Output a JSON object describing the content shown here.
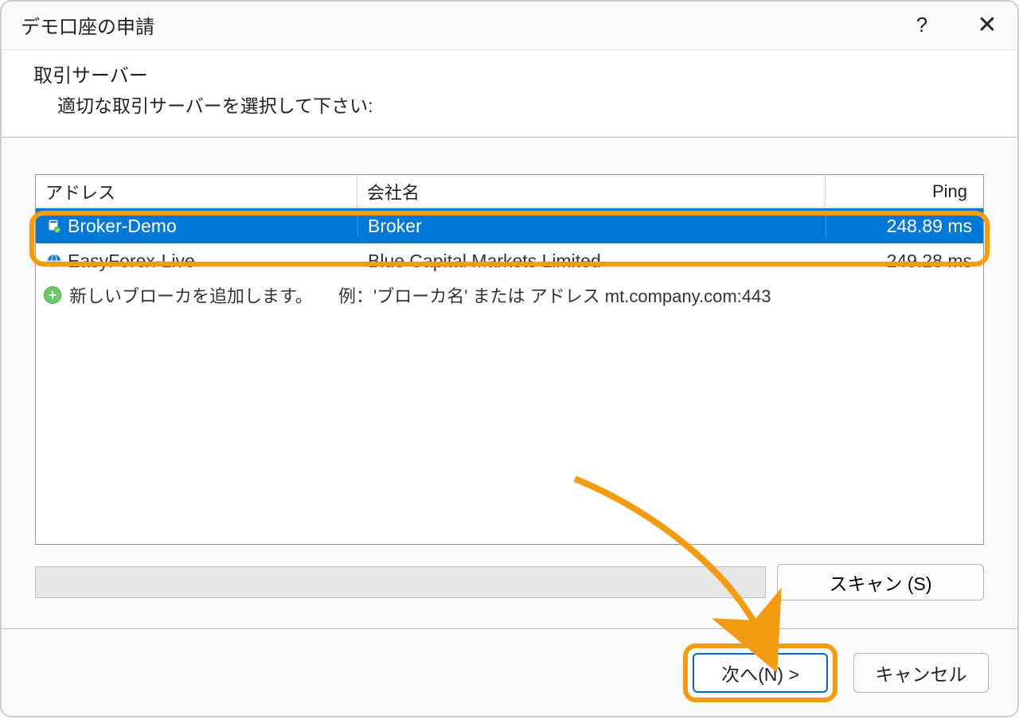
{
  "dialog": {
    "title": "デモ口座の申請",
    "help": "?",
    "close": "✕"
  },
  "header": {
    "section_title": "取引サーバー",
    "section_desc": "適切な取引サーバーを選択して下さい:"
  },
  "columns": {
    "address": "アドレス",
    "company": "会社名",
    "ping": "Ping"
  },
  "rows": [
    {
      "address": "Broker-Demo",
      "company": "Broker",
      "ping": "248.89 ms",
      "selected": true
    },
    {
      "address": "EasyForex-Live",
      "company": "Blue Capital Markets Limited",
      "ping": "249.28 ms",
      "selected": false
    }
  ],
  "add_row": {
    "label": "新しいブローカを追加します。",
    "hint": "例：'ブローカ名' または アドレス mt.company.com:443"
  },
  "buttons": {
    "scan": "スキャン (S)",
    "next": "次へ(N) >",
    "cancel": "キャンセル"
  },
  "colors": {
    "selection": "#0078d7",
    "highlight": "#f39c12"
  }
}
